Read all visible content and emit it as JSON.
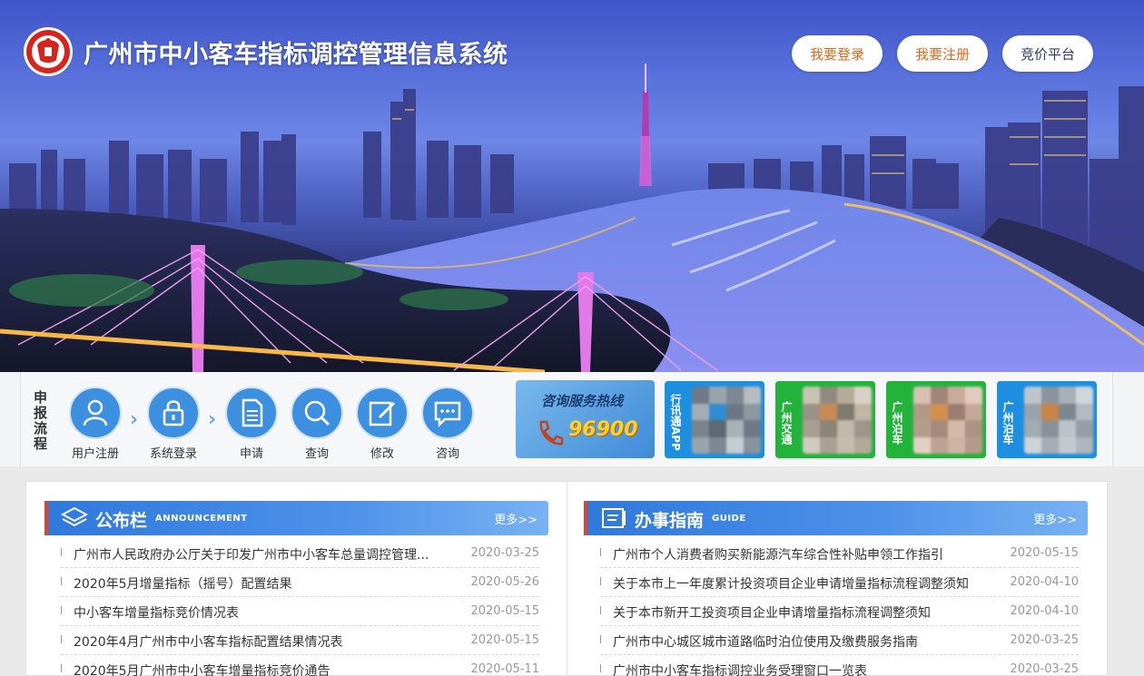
{
  "header": {
    "title": "广州市中小客车指标调控管理信息系统",
    "logo_icon": "emblem-icon",
    "buttons": [
      {
        "label": "我要登录",
        "color": "#e8661a"
      },
      {
        "label": "我要注册",
        "color": "#e8661a"
      },
      {
        "label": "竞价平台",
        "color": "#2a3a6a"
      }
    ]
  },
  "process": {
    "label": "申报流程",
    "steps": [
      {
        "label": "用户注册",
        "icon": "user-icon"
      },
      {
        "label": "系统登录",
        "icon": "lock-icon"
      },
      {
        "label": "申请",
        "icon": "document-icon"
      },
      {
        "label": "查询",
        "icon": "search-icon"
      },
      {
        "label": "修改",
        "icon": "edit-icon"
      },
      {
        "label": "咨询",
        "icon": "chat-icon"
      }
    ],
    "hotline": {
      "title": "咨询服务热线",
      "number": "96900"
    },
    "apps": [
      {
        "label": "行讯通APP",
        "color": "#1e8fe0"
      },
      {
        "label": "广州交通",
        "color": "#22b33a"
      },
      {
        "label": "广州泊车",
        "color": "#22b33a"
      },
      {
        "label": "广州泊车",
        "color": "#1e8fe0"
      }
    ]
  },
  "announcement": {
    "title": "公布栏",
    "en": "ANNOUNCEMENT",
    "more": "更多>>",
    "items": [
      {
        "text": "广州市人民政府办公厅关于印发广州市中小客车总量调控管理...",
        "date": "2020-03-25"
      },
      {
        "text": "2020年5月增量指标（摇号）配置结果",
        "date": "2020-05-26"
      },
      {
        "text": "中小客车增量指标竞价情况表",
        "date": "2020-05-15"
      },
      {
        "text": "2020年4月广州市中小客车指标配置结果情况表",
        "date": "2020-05-15"
      },
      {
        "text": "2020年5月广州市中小客车增量指标竞价通告",
        "date": "2020-05-11"
      }
    ]
  },
  "guide": {
    "title": "办事指南",
    "en": "GUIDE",
    "more": "更多>>",
    "items": [
      {
        "text": "广州市个人消费者购买新能源汽车综合性补贴申领工作指引",
        "date": "2020-05-15"
      },
      {
        "text": "关于本市上一年度累计投资项目企业申请增量指标流程调整须知",
        "date": "2020-04-10"
      },
      {
        "text": "关于本市新开工投资项目企业申请增量指标流程调整须知",
        "date": "2020-04-10"
      },
      {
        "text": "广州市中心城区城市道路临时泊位使用及缴费服务指南",
        "date": "2020-03-25"
      },
      {
        "text": "广州市中小客车指标调控业务受理窗口一览表",
        "date": "2020-03-25"
      }
    ]
  }
}
